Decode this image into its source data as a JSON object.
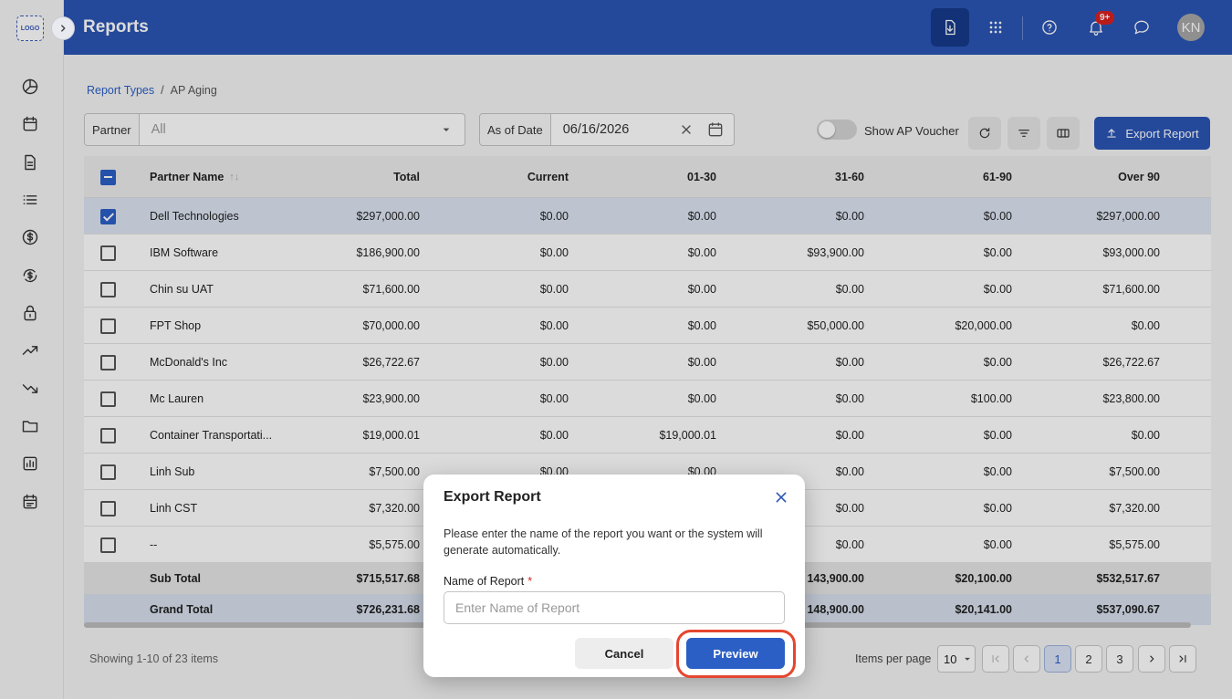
{
  "app": {
    "logo_text": "LOGO",
    "page_title": "Reports",
    "notifications_badge": "9+",
    "avatar_initials": "KN"
  },
  "breadcrumb": {
    "root": "Report Types",
    "separator": "/",
    "current": "AP Aging"
  },
  "filters": {
    "partner_label": "Partner",
    "partner_value": "All",
    "date_label": "As of Date",
    "date_value": "06/16/2026",
    "show_voucher_label": "Show AP Voucher",
    "show_voucher_on": false,
    "export_label": "Export Report"
  },
  "table": {
    "columns": [
      "Partner Name",
      "Total",
      "Current",
      "01-30",
      "31-60",
      "61-90",
      "Over 90"
    ],
    "rows": [
      {
        "selected": true,
        "cells": [
          "Dell Technologies",
          "$297,000.00",
          "$0.00",
          "$0.00",
          "$0.00",
          "$0.00",
          "$297,000.00"
        ]
      },
      {
        "selected": false,
        "cells": [
          "IBM Software",
          "$186,900.00",
          "$0.00",
          "$0.00",
          "$93,900.00",
          "$0.00",
          "$93,000.00"
        ]
      },
      {
        "selected": false,
        "cells": [
          "Chin su UAT",
          "$71,600.00",
          "$0.00",
          "$0.00",
          "$0.00",
          "$0.00",
          "$71,600.00"
        ]
      },
      {
        "selected": false,
        "cells": [
          "FPT Shop",
          "$70,000.00",
          "$0.00",
          "$0.00",
          "$50,000.00",
          "$20,000.00",
          "$0.00"
        ]
      },
      {
        "selected": false,
        "cells": [
          "McDonald's Inc",
          "$26,722.67",
          "$0.00",
          "$0.00",
          "$0.00",
          "$0.00",
          "$26,722.67"
        ]
      },
      {
        "selected": false,
        "cells": [
          "Mc Lauren",
          "$23,900.00",
          "$0.00",
          "$0.00",
          "$0.00",
          "$100.00",
          "$23,800.00"
        ]
      },
      {
        "selected": false,
        "cells": [
          "Container Transportati...",
          "$19,000.01",
          "$0.00",
          "$19,000.01",
          "$0.00",
          "$0.00",
          "$0.00"
        ]
      },
      {
        "selected": false,
        "cells": [
          "Linh Sub",
          "$7,500.00",
          "$0.00",
          "$0.00",
          "$0.00",
          "$0.00",
          "$7,500.00"
        ]
      },
      {
        "selected": false,
        "cells": [
          "Linh CST",
          "$7,320.00",
          "",
          "",
          "$0.00",
          "$0.00",
          "$7,320.00"
        ]
      },
      {
        "selected": false,
        "cells": [
          "--",
          "$5,575.00",
          "",
          "",
          "$0.00",
          "$0.00",
          "$5,575.00"
        ]
      }
    ],
    "sub_total": [
      "Sub Total",
      "$715,517.68",
      "",
      "",
      "143,900.00",
      "$20,100.00",
      "$532,517.67"
    ],
    "grand_total": [
      "Grand Total",
      "$726,231.68",
      "",
      "",
      "148,900.00",
      "$20,141.00",
      "$537,090.67"
    ]
  },
  "pagination": {
    "showing_text": "Showing 1-10 of 23 items",
    "items_per_page_label": "Items per page",
    "items_per_page_value": "10",
    "pages": [
      "1",
      "2",
      "3"
    ],
    "current_page": "1"
  },
  "modal": {
    "title": "Export Report",
    "description": "Please enter the name of the report you want or the system will generate automatically.",
    "field_label": "Name of Report",
    "required_mark": "*",
    "input_placeholder": "Enter Name of Report",
    "input_value": "",
    "cancel_label": "Cancel",
    "preview_label": "Preview"
  },
  "colors": {
    "header": "#2b55b5",
    "primary": "#2b5fc5",
    "highlight": "#e5462f",
    "danger": "#d92121"
  }
}
